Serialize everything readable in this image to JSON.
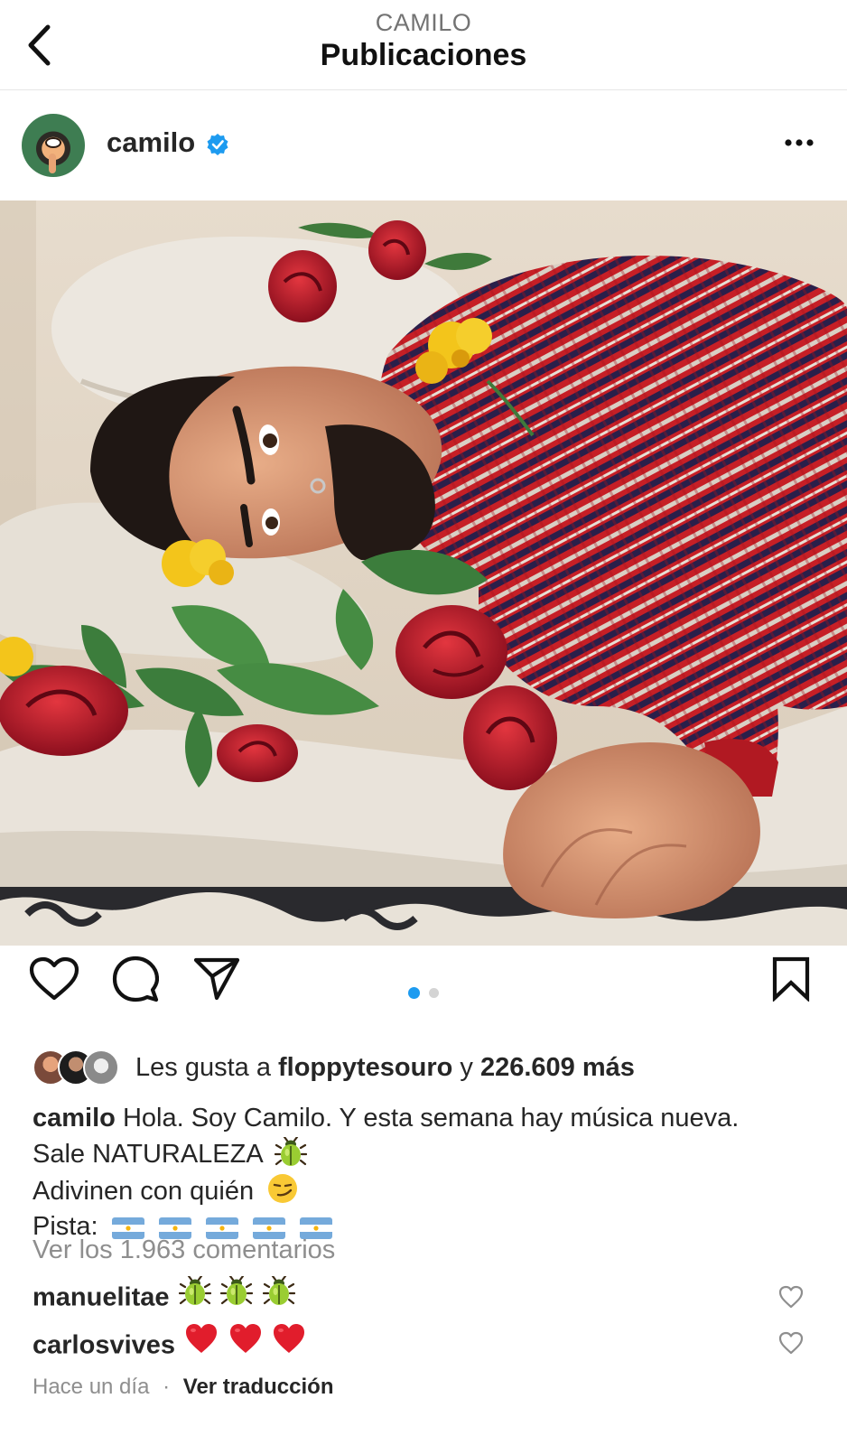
{
  "nav": {
    "account": "CAMILO",
    "title": "Publicaciones"
  },
  "post": {
    "author": "camilo",
    "verified": true,
    "photo_alt_subject": "man-lying-in-bed-with-flowers",
    "carousel": {
      "index": 1,
      "total": 2
    }
  },
  "colors": {
    "accent_blue": "#1d9bf0",
    "text": "#262626",
    "muted": "#8e8e8e",
    "heart_red": "#e11d2c"
  },
  "likes": {
    "prefix": "Les gusta a ",
    "user": "floppytesouro",
    "joiner": " y ",
    "count": "226.609 más"
  },
  "caption": {
    "author": "camilo",
    "line1": "Hola. Soy Camilo. Y esta semana hay música nueva.",
    "line2": "Sale NATURALEZA",
    "line2_emoji": "beetle-emoji",
    "line3": "Adivinen con quién",
    "line3_emoji": "smirk-emoji",
    "line4": "Pista:",
    "line4_emoji": "argentina-flag-emoji",
    "line4_emoji_count": 5
  },
  "comments": {
    "view_all": "Ver los 1.963 comentarios",
    "items": [
      {
        "user": "manuelitae",
        "emoji": "beetle-emoji",
        "emoji_count": 3
      },
      {
        "user": "carlosvives",
        "emoji": "red-heart-emoji",
        "emoji_count": 3
      }
    ]
  },
  "meta": {
    "time": "Hace un día",
    "separator": "·",
    "translate": "Ver traducción"
  }
}
